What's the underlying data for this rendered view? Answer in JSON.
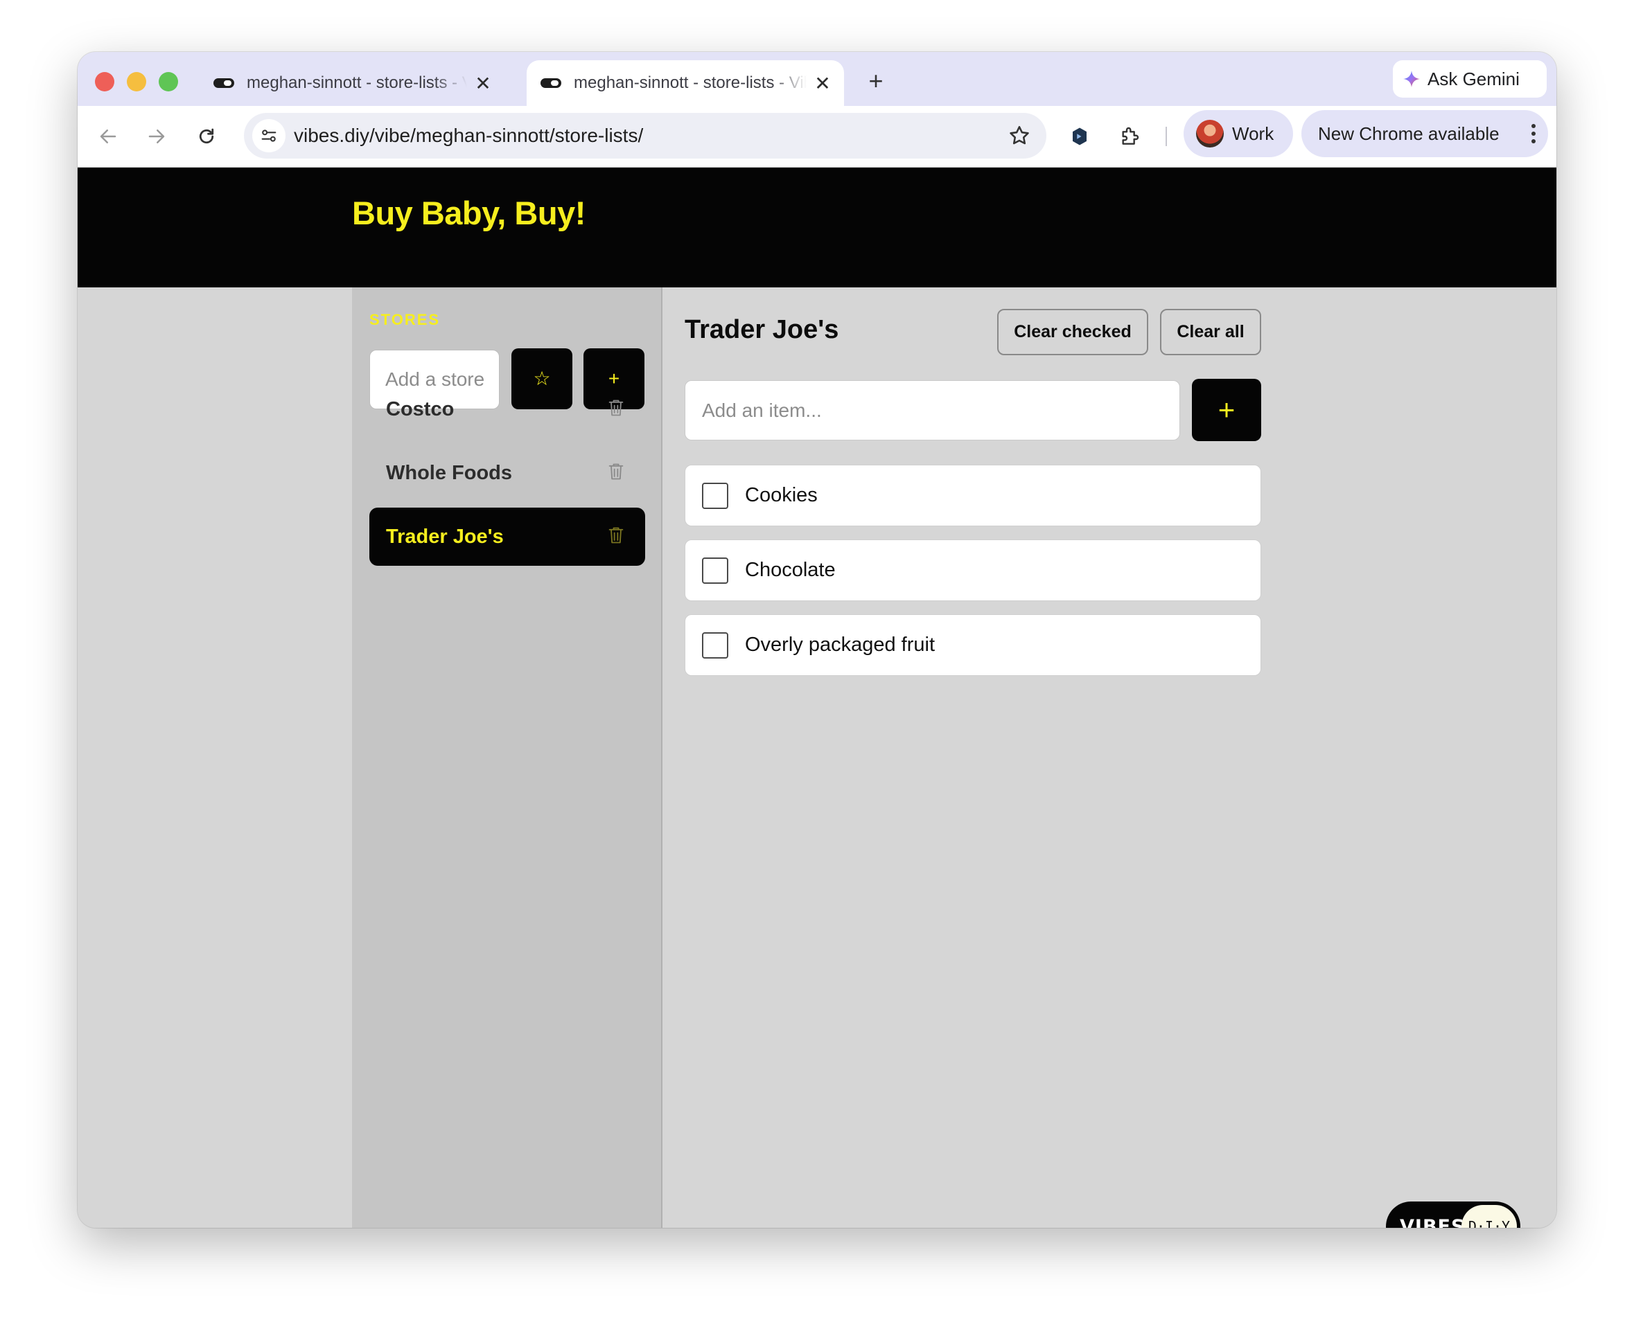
{
  "browser": {
    "tabs": [
      {
        "title": "meghan-sinnott - store-lists - Vibes DIY",
        "close": "✕"
      },
      {
        "title": "meghan-sinnott - store-lists - Vibes DIY",
        "close": "✕"
      }
    ],
    "new_tab": "+",
    "ask_gemini": "Ask Gemini",
    "url": "vibes.diy/vibe/meghan-sinnott/store-lists/",
    "profile_label": "Work",
    "update_label": "New Chrome available"
  },
  "app": {
    "title": "Buy Baby, Buy!",
    "colors": {
      "accent": "#f6ee1e",
      "dark": "#050505",
      "panel": "#c5c5c5",
      "background": "#d6d6d6"
    },
    "sidebar": {
      "heading": "STORES",
      "input_placeholder": "Add a store...",
      "favorite_icon": "☆",
      "add_icon": "+",
      "stores": [
        {
          "name": "Costco",
          "active": false
        },
        {
          "name": "Whole Foods",
          "active": false
        },
        {
          "name": "Trader Joe's",
          "active": true
        }
      ]
    },
    "main": {
      "list_title": "Trader Joe's",
      "clear_checked": "Clear checked",
      "clear_all": "Clear all",
      "item_placeholder": "Add an item...",
      "add_icon": "+",
      "items": [
        {
          "text": "Cookies",
          "checked": false
        },
        {
          "text": "Chocolate",
          "checked": false
        },
        {
          "text": "Overly packaged fruit",
          "checked": false
        }
      ]
    },
    "badge": {
      "word": "VIBES",
      "pill": "D·I·Y"
    }
  }
}
